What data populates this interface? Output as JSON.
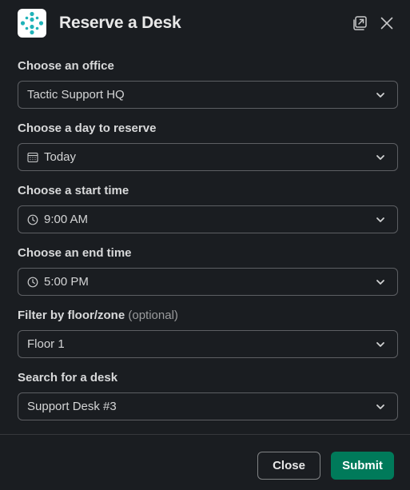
{
  "modal": {
    "title": "Reserve a Desk",
    "popout_icon": "popout-icon",
    "close_icon": "close-icon",
    "app_logo": "tactic-logo-icon"
  },
  "fields": [
    {
      "label": "Choose an office",
      "optional": "",
      "value": "Tactic Support HQ",
      "icon": ""
    },
    {
      "label": "Choose a day to reserve",
      "optional": "",
      "value": "Today",
      "icon": "calendar-icon"
    },
    {
      "label": "Choose a start time",
      "optional": "",
      "value": "9:00 AM",
      "icon": "clock-icon"
    },
    {
      "label": "Choose an end time",
      "optional": "",
      "value": "5:00 PM",
      "icon": "clock-icon"
    },
    {
      "label": "Filter by floor/zone",
      "optional": "(optional)",
      "value": "Floor 1",
      "icon": ""
    },
    {
      "label": "Search for a desk",
      "optional": "",
      "value": "Support Desk #3",
      "icon": ""
    }
  ],
  "footer": {
    "close_label": "Close",
    "submit_label": "Submit"
  },
  "colors": {
    "background": "#1a1d21",
    "submit": "#007a5a",
    "logo_accent": "#1fb2b8"
  }
}
